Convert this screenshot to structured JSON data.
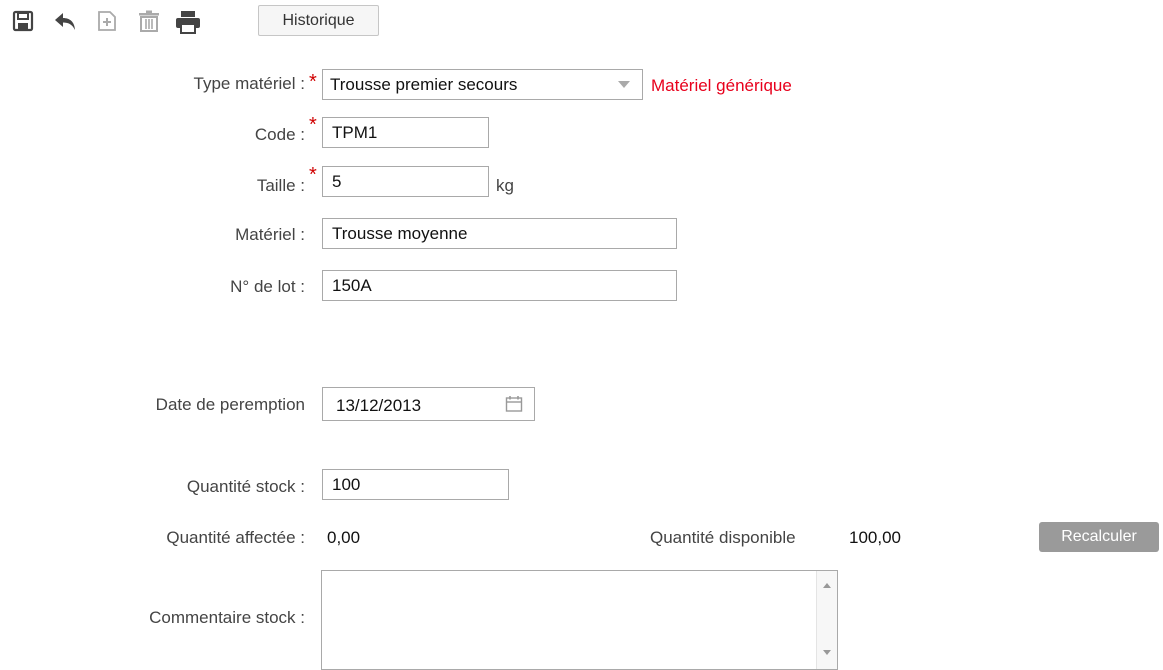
{
  "toolbar": {
    "icons": [
      "save-icon",
      "undo-icon",
      "new-icon",
      "delete-icon",
      "print-icon"
    ],
    "history_label": "Historique"
  },
  "form": {
    "type_label": "Type matériel :",
    "type_value": "Trousse premier secours",
    "type_note": "Matériel générique",
    "code_label": "Code :",
    "code_value": "TPM1",
    "size_label": "Taille :",
    "size_value": "5",
    "size_unit": "kg",
    "material_label": "Matériel :",
    "material_value": "Trousse moyenne",
    "lot_label": "N° de lot :",
    "lot_value": "150A",
    "expiry_label": "Date de peremption",
    "expiry_value": "13/12/2013",
    "stock_qty_label": "Quantité stock :",
    "stock_qty_value": "100",
    "assigned_qty_label": "Quantité affectée :",
    "assigned_qty_value": "0,00",
    "available_qty_label": "Quantité disponible",
    "available_qty_value": "100,00",
    "recalc_label": "Recalculer",
    "comment_label": "Commentaire stock :",
    "comment_value": ""
  },
  "colors": {
    "required": "#d00000",
    "note": "#e8001c",
    "button_bg": "#9a9a9a"
  }
}
